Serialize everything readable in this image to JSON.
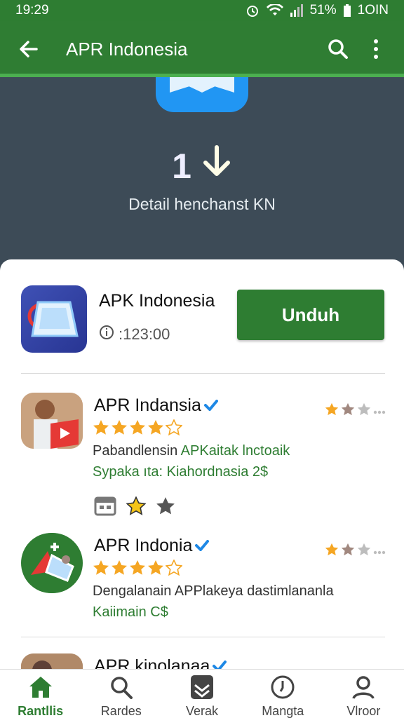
{
  "status_bar": {
    "time": "19:29",
    "battery": "51%",
    "network": "1OIN"
  },
  "app_bar": {
    "title": "APR Indonesia"
  },
  "hero": {
    "count": "1",
    "subtitle": "Detail henchanst KN"
  },
  "featured_app": {
    "name": "APK Indonesia",
    "meta": ":123:00",
    "download_label": "Unduh"
  },
  "list": [
    {
      "name": "APR Indansia",
      "desc1_a": "Pabandlensin ",
      "desc1_b": "APKaitak lnctoaik",
      "desc2": "Sypaka ıta: Kiahordnasia  2$",
      "stars": 4
    },
    {
      "name": "APR Indonia",
      "desc1_a": "Dengalanain APPlakeya dastimlananla",
      "desc1_b": "",
      "desc2": "Kaiimain C$",
      "stars": 4
    },
    {
      "name": "APR kinolanaa"
    }
  ],
  "bottom_nav": [
    {
      "label": "Rantllis",
      "icon": "home-icon"
    },
    {
      "label": "Rardes",
      "icon": "search-icon"
    },
    {
      "label": "Verak",
      "icon": "apps-icon"
    },
    {
      "label": "Mangta",
      "icon": "clock-icon"
    },
    {
      "label": "Vlroor",
      "icon": "profile-icon"
    }
  ],
  "colors": {
    "primary": "#2e7d32",
    "hero_bg": "#3d4b57",
    "star": "#f5a623",
    "verified": "#1e88e5"
  }
}
